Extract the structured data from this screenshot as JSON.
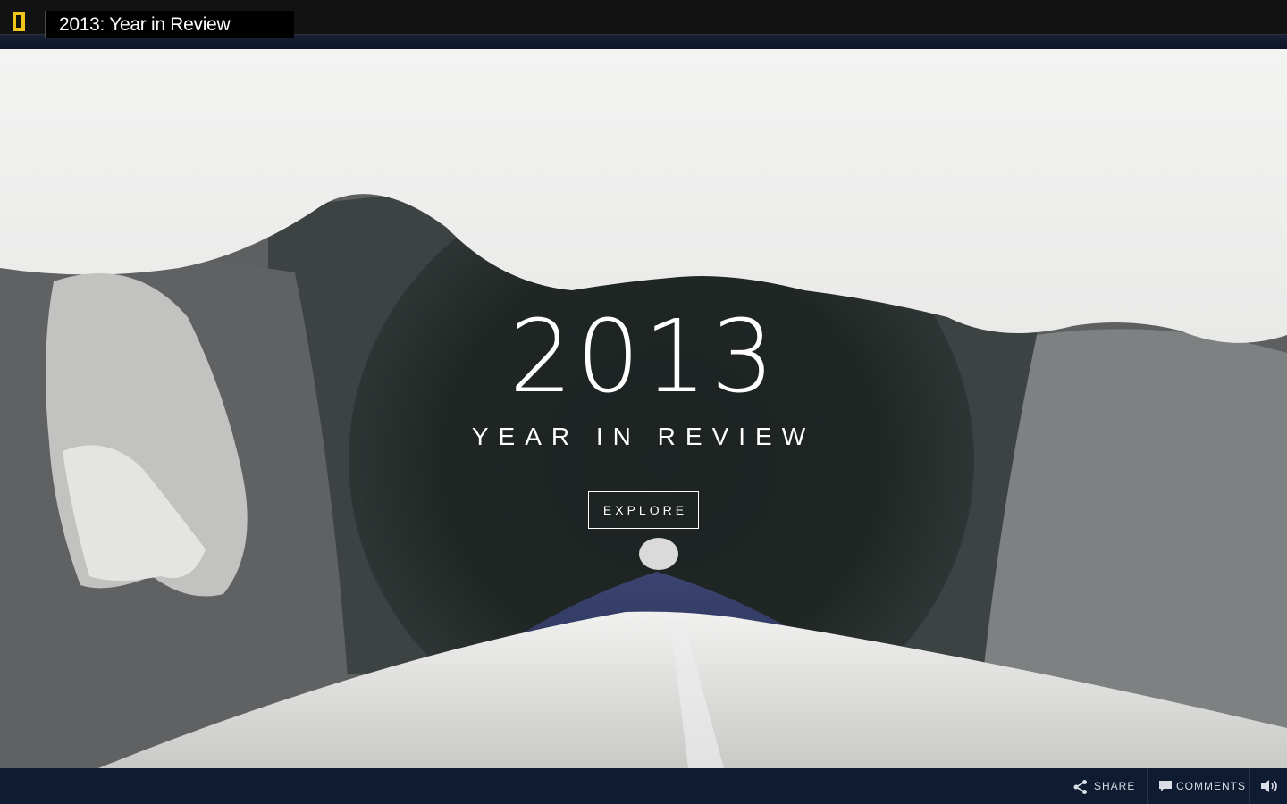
{
  "header": {
    "logo": "national-geographic-logo",
    "title": "2013: Year in Review"
  },
  "hero": {
    "year": "2013",
    "subtitle": "YEAR IN REVIEW",
    "explore_label": "EXPLORE"
  },
  "footer": {
    "share_label": "SHARE",
    "comments_label": "COMMENTS",
    "share_icon": "share-icon",
    "comments_icon": "comment-icon",
    "sound_icon": "speaker-icon"
  },
  "colors": {
    "logo_yellow": "#f2c318",
    "topbar": "#121212",
    "footer": "#0f1b30"
  }
}
